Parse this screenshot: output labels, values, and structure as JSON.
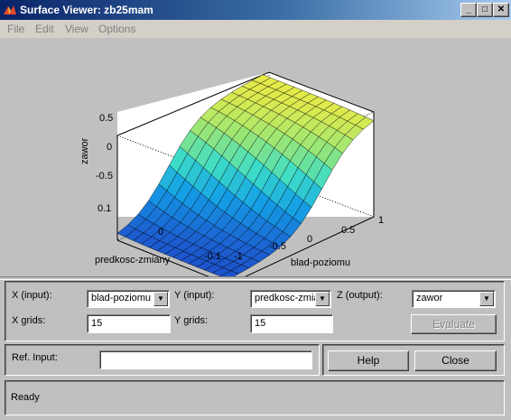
{
  "window": {
    "title": "Surface Viewer: zb25mam"
  },
  "menu": {
    "items": [
      "File",
      "Edit",
      "View",
      "Options"
    ]
  },
  "plot": {
    "zlabel": "zawor",
    "ylabel": "predkosc-zmiany",
    "xlabel": "blad-poziomu",
    "z_ticks": [
      "0.5",
      "0",
      "-0.5"
    ],
    "y_ticks": [
      "0.1",
      "0",
      "-0.1"
    ],
    "x_ticks": [
      "-1",
      "-0.5",
      "0",
      "0.5",
      "1"
    ]
  },
  "chart_data": {
    "type": "surface",
    "xlabel": "blad-poziomu",
    "ylabel": "predkosc-zmiany",
    "zlabel": "zawor",
    "xlim": [
      -1,
      1
    ],
    "ylim": [
      -0.1,
      0.1
    ],
    "zlim": [
      -0.75,
      0.75
    ],
    "grid_points": 15,
    "colormap": "parula-like (blue low to yellow high)"
  },
  "controls": {
    "x_input_label": "X (input):",
    "x_input_value": "blad-poziomu",
    "y_input_label": "Y (input):",
    "y_input_value": "predkosc-zmia",
    "z_output_label": "Z (output):",
    "z_output_value": "zawor",
    "x_grids_label": "X grids:",
    "x_grids_value": "15",
    "y_grids_label": "Y grids:",
    "y_grids_value": "15",
    "evaluate_label": "Evaluate",
    "ref_input_label": "Ref. Input:",
    "ref_input_value": "",
    "help_label": "Help",
    "close_label": "Close"
  },
  "status": {
    "text": "Ready"
  }
}
